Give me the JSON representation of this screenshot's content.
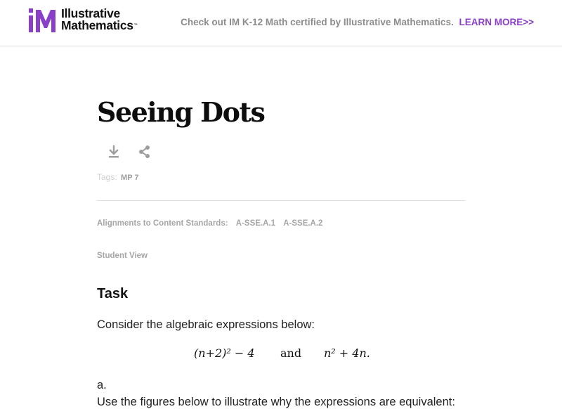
{
  "header": {
    "logo_line1": "Illustrative",
    "logo_line2": "Mathematics",
    "logo_tm": "™",
    "promo_text": "Check out IM K-12 Math certified by Illustrative Mathematics.",
    "promo_link": "LEARN MORE>>"
  },
  "page": {
    "title": "Seeing Dots",
    "tags_label": "Tags:",
    "tag": "MP 7",
    "alignments_label": "Alignments to Content Standards:",
    "standards": [
      "A-SSE.A.1",
      "A-SSE.A.2"
    ],
    "student_view": "Student View"
  },
  "task": {
    "heading": "Task",
    "intro": "Consider the algebraic expressions below:",
    "expr1": "(n+2)² − 4",
    "and": "and",
    "expr2": "n² + 4n.",
    "part_a_label": "a.",
    "part_a_text": "Use the figures below to illustrate why the expressions are equivalent:"
  },
  "colors": {
    "brand_purple": "#8a3fc9",
    "muted_gray": "#a6a6a6"
  },
  "icons": [
    "download-icon",
    "share-icon"
  ]
}
